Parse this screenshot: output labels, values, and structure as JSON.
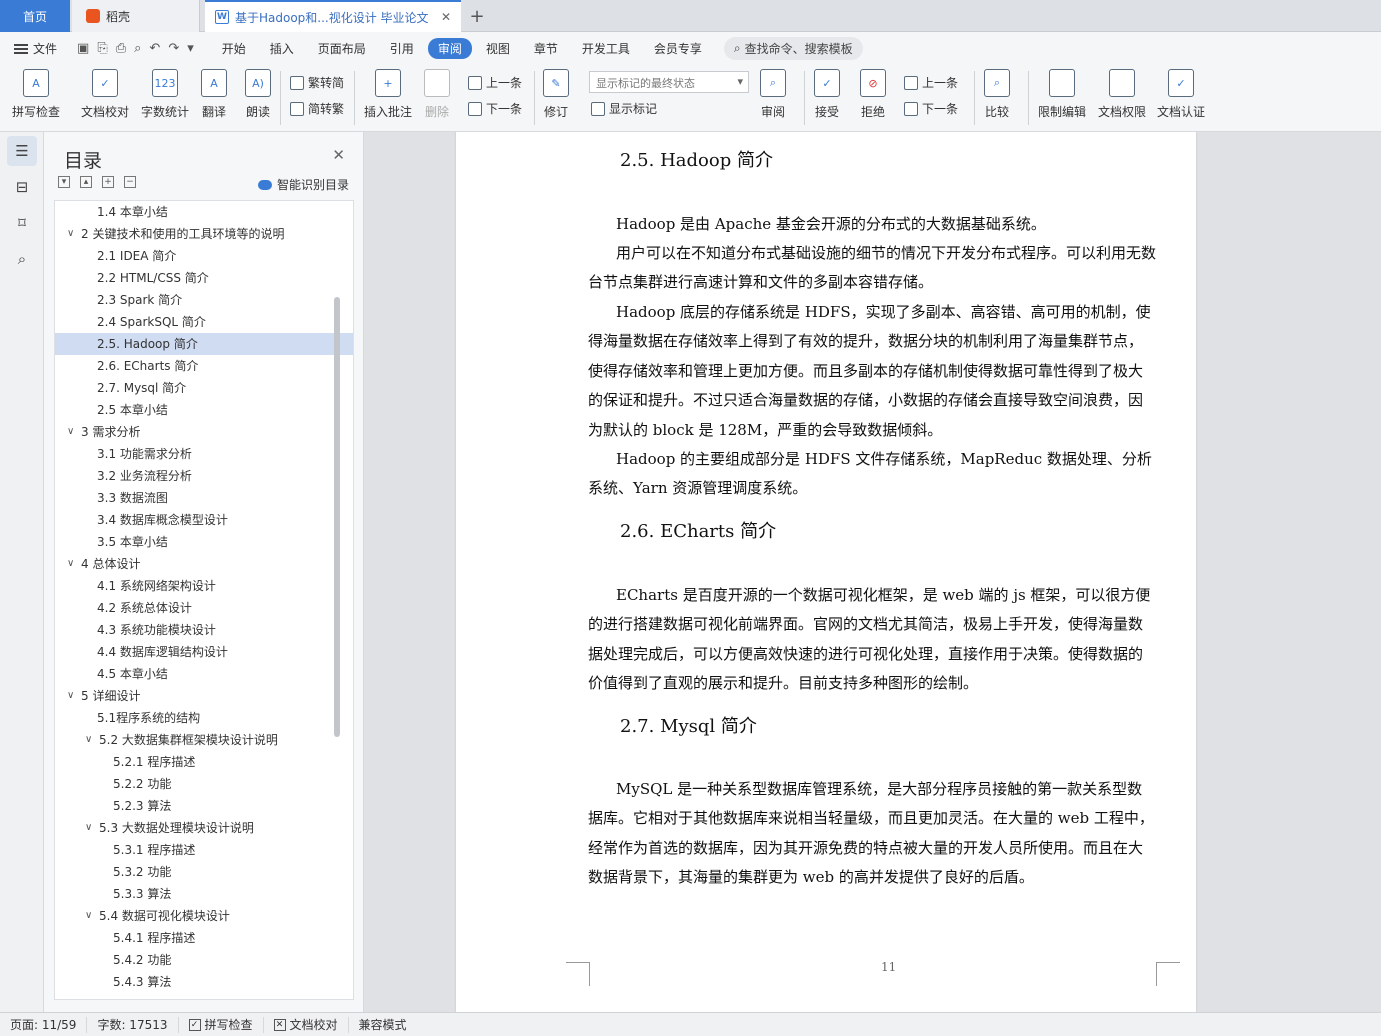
{
  "tabs": {
    "home": "首页",
    "doke": "稻壳",
    "doc": "基于Hadoop和...视化设计 毕业论文",
    "add": "+"
  },
  "menu": {
    "file": "文件",
    "tabs": [
      "开始",
      "插入",
      "页面布局",
      "引用",
      "审阅",
      "视图",
      "章节",
      "开发工具",
      "会员专享"
    ],
    "active_tab": "审阅",
    "search": "查找命令、搜索模板"
  },
  "ribbon": {
    "spell": "拼写检查",
    "proof": "文档校对",
    "wordcount": "字数统计",
    "translate": "翻译",
    "read": "朗读",
    "trad_to_simp": "繁转简",
    "simp_to_trad": "简转繁",
    "insert_comment": "插入批注",
    "delete": "删除",
    "prev1": "上一条",
    "next1": "下一条",
    "track": "修订",
    "markup_state": "显示标记的最终状态",
    "show_markup": "显示标记",
    "review": "审阅",
    "accept": "接受",
    "reject": "拒绝",
    "prev2": "上一条",
    "next2": "下一条",
    "compare": "比较",
    "restrict": "限制编辑",
    "permission": "文档权限",
    "certify": "文档认证"
  },
  "toc": {
    "title": "目录",
    "smart": "智能识别目录",
    "items": [
      {
        "label": "1.4  本章小结",
        "level": 2
      },
      {
        "label": "2    关键技术和使用的工具环境等的说明",
        "level": 1,
        "expanded": true
      },
      {
        "label": "2.1 IDEA 简介",
        "level": 2
      },
      {
        "label": "2.2 HTML/CSS 简介",
        "level": 2
      },
      {
        "label": "2.3 Spark 简介",
        "level": 2
      },
      {
        "label": "2.4 SparkSQL 简介",
        "level": 2
      },
      {
        "label": "2.5. Hadoop 简介",
        "level": 2,
        "selected": true
      },
      {
        "label": "2.6. ECharts 简介",
        "level": 2
      },
      {
        "label": "2.7. Mysql 简介",
        "level": 2
      },
      {
        "label": "2.5  本章小结",
        "level": 2
      },
      {
        "label": "3    需求分析",
        "level": 1,
        "expanded": true
      },
      {
        "label": "3.1  功能需求分析",
        "level": 2
      },
      {
        "label": "3.2  业务流程分析",
        "level": 2
      },
      {
        "label": "3.3  数据流图",
        "level": 2
      },
      {
        "label": "3.4  数据库概念模型设计",
        "level": 2
      },
      {
        "label": "3.5  本章小结",
        "level": 2
      },
      {
        "label": "4    总体设计",
        "level": 1,
        "expanded": true
      },
      {
        "label": "4.1  系统网络架构设计",
        "level": 2
      },
      {
        "label": "4.2  系统总体设计",
        "level": 2
      },
      {
        "label": "4.3  系统功能模块设计",
        "level": 2
      },
      {
        "label": "4.4  数据库逻辑结构设计",
        "level": 2
      },
      {
        "label": "4.5  本章小结",
        "level": 2
      },
      {
        "label": "5    详细设计",
        "level": 1,
        "expanded": true
      },
      {
        "label": "5.1程序系统的结构",
        "level": 2
      },
      {
        "label": "5.2    大数据集群框架模块设计说明",
        "level": 2,
        "expanded": true
      },
      {
        "label": "5.2.1  程序描述",
        "level": 3
      },
      {
        "label": "5.2.2  功能",
        "level": 3
      },
      {
        "label": "5.2.3  算法",
        "level": 3
      },
      {
        "label": "5.3    大数据处理模块设计说明",
        "level": 2,
        "expanded": true
      },
      {
        "label": "5.3.1  程序描述",
        "level": 3
      },
      {
        "label": "5.3.2  功能",
        "level": 3
      },
      {
        "label": "5.3.3  算法",
        "level": 3
      },
      {
        "label": "5.4    数据可视化模块设计",
        "level": 2,
        "expanded": true
      },
      {
        "label": "5.4.1  程序描述",
        "level": 3
      },
      {
        "label": "5.4.2  功能",
        "level": 3
      },
      {
        "label": "5.4.3  算法",
        "level": 3
      }
    ]
  },
  "document": {
    "h25": "2.5. Hadoop 简介",
    "p1": "Hadoop 是由 Apache 基金会开源的分布式的大数据基础系统。",
    "p2": "用户可以在不知道分布式基础设施的细节的情况下开发分布式程序。可以利用无数台节点集群进行高速计算和文件的多副本容错存储。",
    "p3": "Hadoop 底层的存储系统是 HDFS，实现了多副本、高容错、高可用的机制，使得海量数据在存储效率上得到了有效的提升，数据分块的机制利用了海量集群节点，使得存储效率和管理上更加方便。而且多副本的存储机制使得数据可靠性得到了极大的保证和提升。不过只适合海量数据的存储，小数据的存储会直接导致空间浪费，因为默认的 block 是 128M，严重的会导致数据倾斜。",
    "p4": "Hadoop 的主要组成部分是 HDFS 文件存储系统，MapReduc 数据处理、分析系统、Yarn 资源管理调度系统。",
    "h26": "2.6. ECharts 简介",
    "p5": "ECharts 是百度开源的一个数据可视化框架，是 web 端的 js 框架，可以很方便的进行搭建数据可视化前端界面。官网的文档尤其简洁，极易上手开发，使得海量数据处理完成后，可以方便高效快速的进行可视化处理，直接作用于决策。使得数据的价值得到了直观的展示和提升。目前支持多种图形的绘制。",
    "h27": "2.7. Mysql 简介",
    "p6": "MySQL 是一种关系型数据库管理系统，是大部分程序员接触的第一款关系型数据库。它相对于其他数据库来说相当轻量级，而且更加灵活。在大量的 web 工程中，经常作为首选的数据库，因为其开源免费的特点被大量的开发人员所使用。而且在大数据背景下，其海量的集群更为 web 的高并发提供了良好的后盾。",
    "page_number": "11"
  },
  "status": {
    "page": "页面: 11/59",
    "words": "字数: 17513",
    "spell": "拼写检查",
    "proof": "文档校对",
    "compat": "兼容模式"
  },
  "colors": {
    "accent": "#3a7bd5",
    "doke": "#e9541f",
    "selected_toc": "#cfdcf2"
  }
}
